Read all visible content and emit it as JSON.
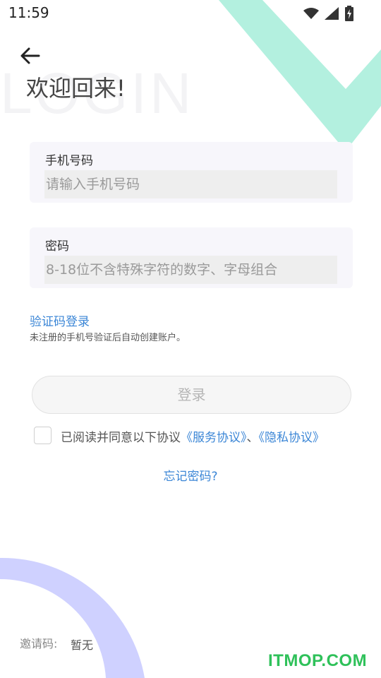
{
  "status_bar": {
    "time": "11:59"
  },
  "background": {
    "watermark": "LOGIN"
  },
  "header": {
    "title": "欢迎回来!"
  },
  "form": {
    "phone": {
      "label": "手机号码",
      "placeholder": "请输入手机号码",
      "value": ""
    },
    "password": {
      "label": "密码",
      "placeholder": "8-18位不含特殊字符的数字、字母组合",
      "value": ""
    },
    "sms_login_link": "验证码登录",
    "sms_hint": "未注册的手机号验证后自动创建账户。",
    "login_button": "登录",
    "agreement": {
      "checked": false,
      "prefix": "已阅读并同意以下协议",
      "service_link": "《服务协议》",
      "separator": "、",
      "privacy_link": "《隐私协议》"
    },
    "forgot_password": "忘记密码?"
  },
  "invite": {
    "label": "邀请码:",
    "value": "暂无"
  },
  "watermark_brand": "ITMOP.COM",
  "colors": {
    "link": "#3b86d6",
    "check_deco": "#b3f0df",
    "arc_deco": "#cfd1ff",
    "field_bg": "#f7f6fb",
    "brand": "#2fc15a"
  }
}
